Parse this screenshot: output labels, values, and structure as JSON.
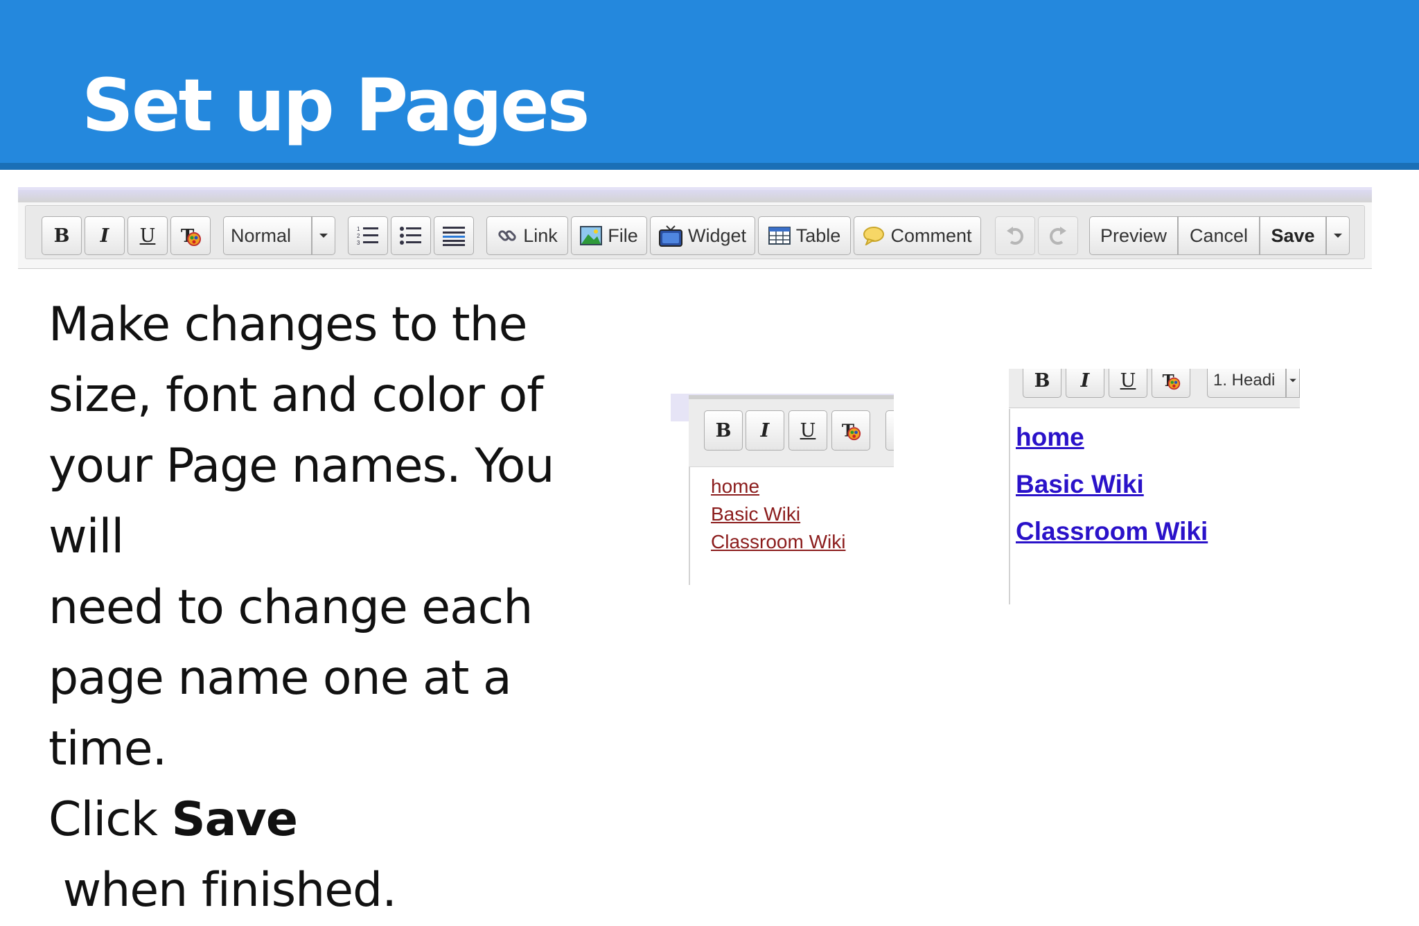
{
  "slide": {
    "title": "Set up Pages",
    "body": {
      "lines": [
        "Make changes to the",
        "size, font and color of",
        "your Page names. You will",
        "need to change each",
        "page name one at a time."
      ],
      "last_line_prefix": "Click ",
      "last_line_bold": "Save",
      "last_line_suffix": " when finished."
    }
  },
  "toolbar": {
    "bold": "B",
    "italic": "I",
    "underline": "U",
    "format_value": "Normal",
    "link": "Link",
    "file": "File",
    "widget": "Widget",
    "table": "Table",
    "comment": "Comment",
    "preview": "Preview",
    "cancel": "Cancel",
    "save": "Save"
  },
  "before_example": {
    "bold": "B",
    "italic": "I",
    "underline": "U",
    "links": [
      "home",
      "Basic Wiki",
      "Classroom Wiki"
    ],
    "link_color": "#8b1c1c"
  },
  "after_example": {
    "bold": "B",
    "italic": "I",
    "underline": "U",
    "format_value": "1. Headi",
    "links": [
      "home",
      "Basic Wiki",
      "Classroom Wiki"
    ],
    "link_color": "#2a12c9"
  },
  "colors": {
    "header_bg": "#2488dd",
    "header_border": "#1a6fb6"
  }
}
